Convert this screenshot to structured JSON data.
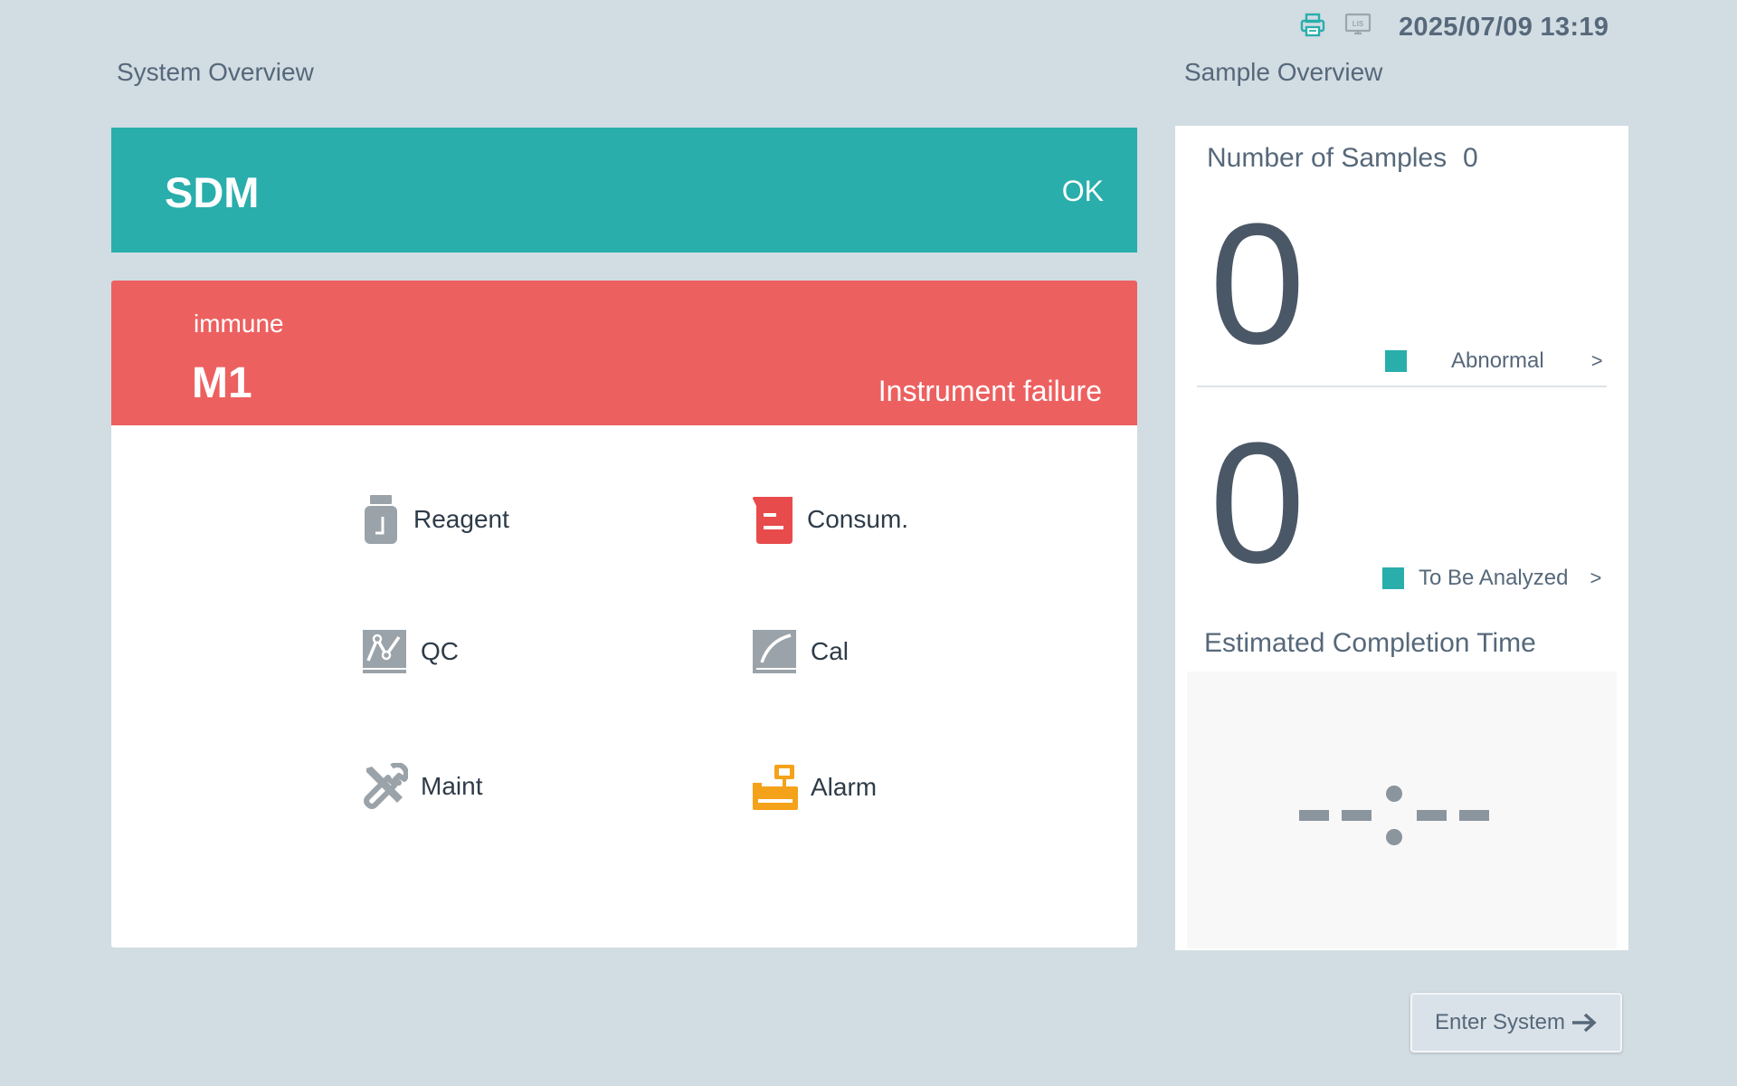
{
  "topbar": {
    "icons": [
      "printer-icon",
      "lis-icon"
    ],
    "lis_text": "LIS",
    "datetime": "2025/07/09 13:19"
  },
  "system_overview": {
    "title": "System Overview",
    "sdm": {
      "name": "SDM",
      "status": "OK",
      "color": "#29aeab"
    },
    "module": {
      "subtitle": "immune",
      "name": "M1",
      "status": "Instrument failure",
      "color": "#ed6060",
      "functions": [
        {
          "label": "Reagent",
          "icon": "reagent-bottle-icon"
        },
        {
          "label": "Consum.",
          "icon": "consumable-icon"
        },
        {
          "label": "QC",
          "icon": "qc-chart-icon"
        },
        {
          "label": "Cal",
          "icon": "calibration-curve-icon"
        },
        {
          "label": "Maint",
          "icon": "wrench-screwdriver-icon"
        },
        {
          "label": "Alarm",
          "icon": "alarm-icon"
        }
      ]
    }
  },
  "sample_overview": {
    "title": "Sample Overview",
    "number_label": "Number of Samples",
    "number_value": "0",
    "abnormal": {
      "count": "0",
      "label": "Abnormal",
      "chevron": ">"
    },
    "to_be_analyzed": {
      "count": "0",
      "label": "To Be Analyzed",
      "chevron": ">"
    },
    "completion_label": "Estimated Completion Time",
    "completion_value": "--:--"
  },
  "actions": {
    "enter_system": "Enter System"
  },
  "colors": {
    "background": "#d1dce3",
    "ok": "#29aeab",
    "failure": "#ed6060",
    "consumable": "#e84b4b",
    "alarm": "#f5a21b",
    "icon_gray": "#9aa3a9"
  }
}
